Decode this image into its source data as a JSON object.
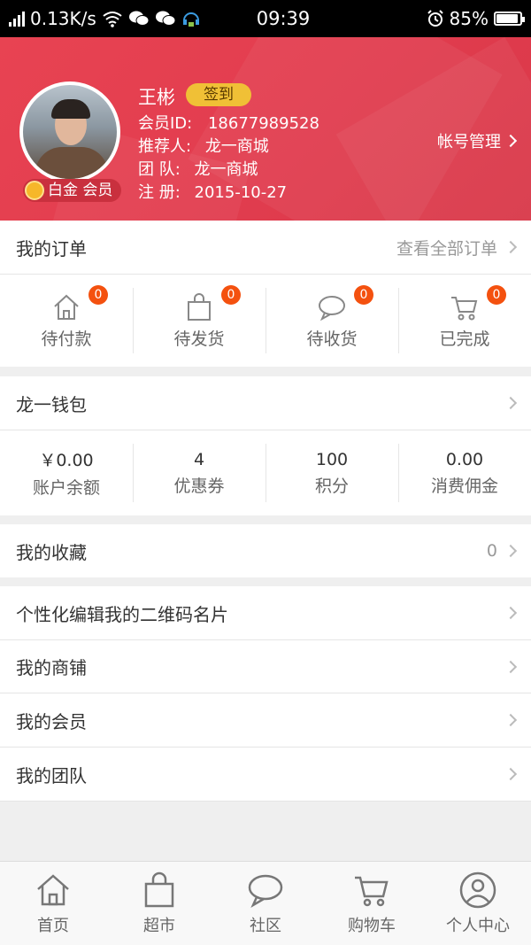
{
  "status_bar": {
    "network_speed": "0.13K/s",
    "time": "09:39",
    "battery": "85%",
    "battery_level": 0.85
  },
  "profile": {
    "name": "王彬",
    "signin_label": "签到",
    "member_id_label": "会员ID:",
    "member_id": "18677989528",
    "referrer_label": "推荐人:",
    "referrer": "龙一商城",
    "team_label": "团 队:",
    "team": "龙一商城",
    "register_label": "注 册:",
    "register_date": "2015-10-27",
    "level_badge": "白金 会员",
    "account_manage": "帐号管理"
  },
  "orders": {
    "title": "我的订单",
    "view_all": "查看全部订单",
    "items": [
      {
        "label": "待付款",
        "count": "0",
        "icon": "home-icon"
      },
      {
        "label": "待发货",
        "count": "0",
        "icon": "bag-icon"
      },
      {
        "label": "待收货",
        "count": "0",
        "icon": "chat-bubble-icon"
      },
      {
        "label": "已完成",
        "count": "0",
        "icon": "cart-icon"
      }
    ]
  },
  "wallet": {
    "title": "龙一钱包",
    "items": [
      {
        "value": "￥0.00",
        "label": "账户余额"
      },
      {
        "value": "4",
        "label": "优惠券"
      },
      {
        "value": "100",
        "label": "积分"
      },
      {
        "value": "0.00",
        "label": "消费佣金"
      }
    ]
  },
  "favorites": {
    "title": "我的收藏",
    "count": "0"
  },
  "menu": [
    {
      "label": "个性化编辑我的二维码名片"
    },
    {
      "label": "我的商铺"
    },
    {
      "label": "我的会员"
    },
    {
      "label": "我的团队"
    }
  ],
  "tabbar": [
    {
      "label": "首页",
      "icon": "home-icon"
    },
    {
      "label": "超市",
      "icon": "bag-icon"
    },
    {
      "label": "社区",
      "icon": "chat-bubble-icon"
    },
    {
      "label": "购物车",
      "icon": "cart-icon"
    },
    {
      "label": "个人中心",
      "icon": "user-icon"
    }
  ],
  "colors": {
    "header": "#e23d4f",
    "signin": "#f0c036",
    "count_badge": "#f4510f"
  }
}
